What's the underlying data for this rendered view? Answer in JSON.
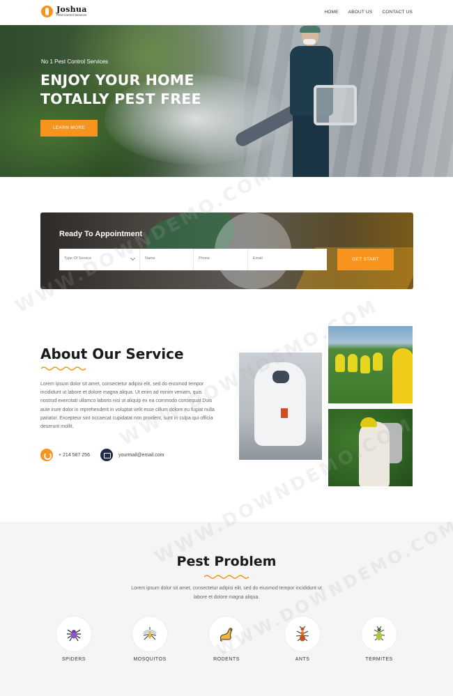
{
  "header": {
    "logo_name": "Joshua",
    "logo_sub": "Pest Control Services",
    "nav": [
      "HOME",
      "ABOUT US",
      "CONTACT US"
    ]
  },
  "hero": {
    "tag": "No 1 Pest Control Services",
    "title_line1": "ENJOY YOUR HOME",
    "title_line2": "TOTALLY PEST FREE",
    "button": "LEARN MORE"
  },
  "appointment": {
    "title": "Ready To Appointment",
    "select_value": "Type Of Service",
    "name_placeholder": "Name",
    "phone_placeholder": "Phone",
    "email_placeholder": "Email",
    "button": "GET START"
  },
  "about": {
    "title": "About Our Service",
    "text": "Lorem ipsum dolor sit amet, consectetur adipisi elit, sed do eiusmod tempor incididunt ut labore et dolore magna aliqua. Ut enim ad minim veniam, quis nostrud exercitati ullamco laboris nisi ut aliquip ex ea commodo consequat Duis aute irure dolor in reprehenderit in voluptat velit esse cillum dolore eu fugiat nulla pariatur. Excepteur sint occaecat cupidatat non proident, sunt in culpa qui officia deserunt mollit.",
    "phone": "+ 214 587 256",
    "email": "yourmail@email.com"
  },
  "pests": {
    "title": "Pest Problem",
    "description": "Lorem ipsum dolor sit amet, consectetur adipisi elit, sed do eiusmod tempor incididunt ut labore et dolore magna aliqua.",
    "items": [
      {
        "label": "SPIDERS",
        "icon": "spider-icon"
      },
      {
        "label": "MOSQUITOS",
        "icon": "mosquito-icon"
      },
      {
        "label": "RODENTS",
        "icon": "rodent-icon"
      },
      {
        "label": "ANTS",
        "icon": "ant-icon"
      },
      {
        "label": "TERMITES",
        "icon": "termite-icon"
      }
    ]
  },
  "watermark": "WWW.DOWNDEMO.COM",
  "colors": {
    "accent": "#f7941d",
    "dark": "#1d2a4a",
    "section_bg": "#f5f5f5"
  }
}
